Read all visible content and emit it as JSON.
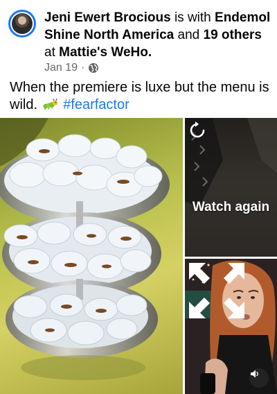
{
  "post": {
    "author": "Jeni Ewert Brocious",
    "is_with": "is with",
    "with_entity": "Endemol Shine North America",
    "and": "and",
    "others": "19 others",
    "at": "at",
    "location": "Mattie's WeHo.",
    "date": "Jan 19",
    "separator": "·",
    "privacy_icon": "globe-icon",
    "caption_text": "When the premiere is luxe but the menu is wild.",
    "caption_emoji": "caterpillar-emoji",
    "hashtag": "#fearfactor"
  },
  "media": {
    "video_overlay": {
      "replay_icon": "replay-icon",
      "label": "Watch again"
    },
    "expand_icon": "expand-icon",
    "sound_icon": "speaker-icon"
  },
  "colors": {
    "link_blue": "#1877f2",
    "meta_gray": "#65676b",
    "text": "#050505"
  }
}
